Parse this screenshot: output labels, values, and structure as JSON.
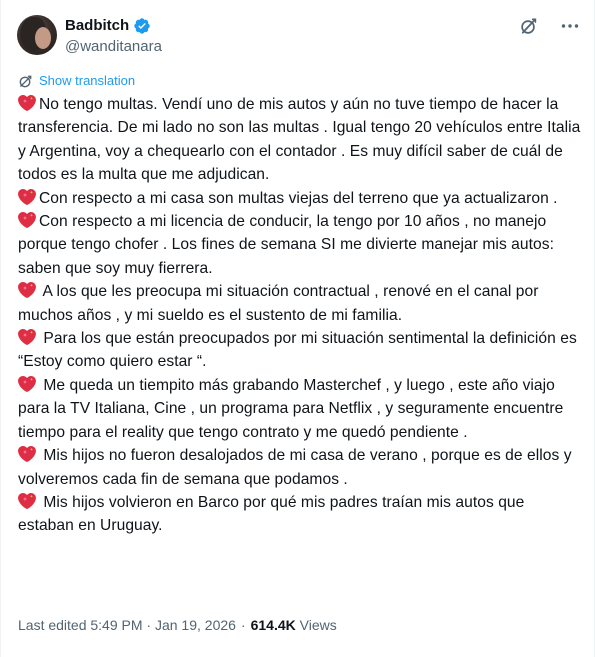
{
  "author": {
    "display_name": "Badbitch",
    "handle": "@wanditanara",
    "verified_color": "#1d9bf0"
  },
  "actions": {
    "grok_icon": "grok-icon",
    "more_icon": "more-icon"
  },
  "translate": {
    "label": "Show translation",
    "icon": "translate-icon"
  },
  "tweet": {
    "paragraphs": [
      {
        "icon": "heart-icon",
        "text": "No tengo multas. Vendí uno de mis autos y aún no tuve tiempo de hacer la transferencia. De mi lado no son las multas . Igual tengo 20 vehículos entre Italia  y Argentina,  voy a chequearlo con el contador . Es muy difícil saber de cuál de todos es la multa que me adjudican."
      },
      {
        "icon": "heart-icon",
        "text": "Con respecto a mi casa son multas viejas del terreno que ya actualizaron ."
      },
      {
        "icon": "heart-icon",
        "text": "Con respecto a mi licencia de conducir,  la tengo por 10 años , no manejo porque tengo chofer . Los fines de semana SI me divierte manejar mis autos: saben que soy muy fierrera."
      },
      {
        "icon": "heart-icon",
        "text": " A los que les preocupa mi situación contractual , renové en el canal por muchos años , y mi sueldo es el sustento de mi familia."
      },
      {
        "icon": "heart-icon",
        "text": " Para los que están preocupados por mi situación sentimental la definición es “Estoy como quiero estar “."
      },
      {
        "icon": "heart-icon",
        "text": " Me queda un tiempito más grabando Masterchef , y luego , este año viajo  para la TV Italiana, Cine , un programa para Netflix , y seguramente encuentre tiempo para el reality que tengo contrato y me quedó pendiente ."
      },
      {
        "icon": "heart-icon",
        "text": " Mis hijos no fueron desalojados de mi casa de verano , porque es de ellos y volveremos cada fin de  semana que podamos ."
      },
      {
        "icon": "heart-icon",
        "text": " Mis hijos volvieron en Barco por qué mis padres traían mis autos que estaban en Uruguay."
      }
    ]
  },
  "meta": {
    "edited": "Last edited 5:49 PM · Jan 19, 2026",
    "separator": "·",
    "views_count": "614.4K",
    "views_label": "Views"
  },
  "colors": {
    "text": "#0f1419",
    "secondary": "#536471",
    "link": "#1d9bf0",
    "heart": "#e0245e"
  }
}
